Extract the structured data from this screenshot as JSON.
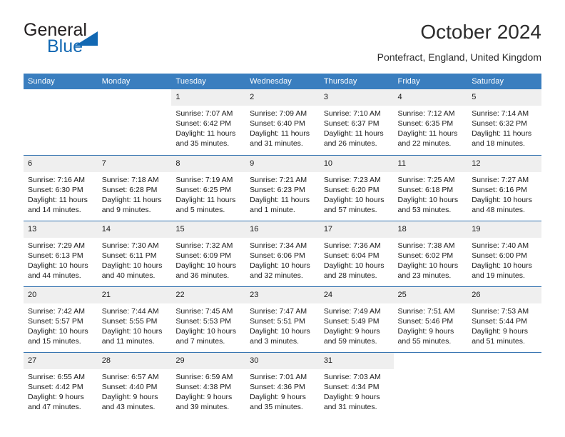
{
  "brand": {
    "word_top": "General",
    "word_bottom": "Blue",
    "accent_color": "#1268b3",
    "triangle_icon": "triangle-logo-icon"
  },
  "header": {
    "title": "October 2024",
    "subtitle": "Pontefract, England, United Kingdom"
  },
  "theme": {
    "header_row_bg": "#3a7ebf",
    "header_row_text": "#ffffff",
    "row_divider": "#2f6fae",
    "daynum_band_bg": "#efefef",
    "body_text": "#1a1a1a"
  },
  "labels": {
    "sunrise_prefix": "Sunrise:",
    "sunset_prefix": "Sunset:",
    "daylight_prefix": "Daylight:"
  },
  "weekday_headers": [
    "Sunday",
    "Monday",
    "Tuesday",
    "Wednesday",
    "Thursday",
    "Friday",
    "Saturday"
  ],
  "weeks": [
    [
      {
        "day": "",
        "sunrise": "",
        "sunset": "",
        "daylight": "",
        "blank": true
      },
      {
        "day": "",
        "sunrise": "",
        "sunset": "",
        "daylight": "",
        "blank": true
      },
      {
        "day": "1",
        "sunrise": "Sunrise: 7:07 AM",
        "sunset": "Sunset: 6:42 PM",
        "daylight": "Daylight: 11 hours and 35 minutes."
      },
      {
        "day": "2",
        "sunrise": "Sunrise: 7:09 AM",
        "sunset": "Sunset: 6:40 PM",
        "daylight": "Daylight: 11 hours and 31 minutes."
      },
      {
        "day": "3",
        "sunrise": "Sunrise: 7:10 AM",
        "sunset": "Sunset: 6:37 PM",
        "daylight": "Daylight: 11 hours and 26 minutes."
      },
      {
        "day": "4",
        "sunrise": "Sunrise: 7:12 AM",
        "sunset": "Sunset: 6:35 PM",
        "daylight": "Daylight: 11 hours and 22 minutes."
      },
      {
        "day": "5",
        "sunrise": "Sunrise: 7:14 AM",
        "sunset": "Sunset: 6:32 PM",
        "daylight": "Daylight: 11 hours and 18 minutes."
      }
    ],
    [
      {
        "day": "6",
        "sunrise": "Sunrise: 7:16 AM",
        "sunset": "Sunset: 6:30 PM",
        "daylight": "Daylight: 11 hours and 14 minutes."
      },
      {
        "day": "7",
        "sunrise": "Sunrise: 7:18 AM",
        "sunset": "Sunset: 6:28 PM",
        "daylight": "Daylight: 11 hours and 9 minutes."
      },
      {
        "day": "8",
        "sunrise": "Sunrise: 7:19 AM",
        "sunset": "Sunset: 6:25 PM",
        "daylight": "Daylight: 11 hours and 5 minutes."
      },
      {
        "day": "9",
        "sunrise": "Sunrise: 7:21 AM",
        "sunset": "Sunset: 6:23 PM",
        "daylight": "Daylight: 11 hours and 1 minute."
      },
      {
        "day": "10",
        "sunrise": "Sunrise: 7:23 AM",
        "sunset": "Sunset: 6:20 PM",
        "daylight": "Daylight: 10 hours and 57 minutes."
      },
      {
        "day": "11",
        "sunrise": "Sunrise: 7:25 AM",
        "sunset": "Sunset: 6:18 PM",
        "daylight": "Daylight: 10 hours and 53 minutes."
      },
      {
        "day": "12",
        "sunrise": "Sunrise: 7:27 AM",
        "sunset": "Sunset: 6:16 PM",
        "daylight": "Daylight: 10 hours and 48 minutes."
      }
    ],
    [
      {
        "day": "13",
        "sunrise": "Sunrise: 7:29 AM",
        "sunset": "Sunset: 6:13 PM",
        "daylight": "Daylight: 10 hours and 44 minutes."
      },
      {
        "day": "14",
        "sunrise": "Sunrise: 7:30 AM",
        "sunset": "Sunset: 6:11 PM",
        "daylight": "Daylight: 10 hours and 40 minutes."
      },
      {
        "day": "15",
        "sunrise": "Sunrise: 7:32 AM",
        "sunset": "Sunset: 6:09 PM",
        "daylight": "Daylight: 10 hours and 36 minutes."
      },
      {
        "day": "16",
        "sunrise": "Sunrise: 7:34 AM",
        "sunset": "Sunset: 6:06 PM",
        "daylight": "Daylight: 10 hours and 32 minutes."
      },
      {
        "day": "17",
        "sunrise": "Sunrise: 7:36 AM",
        "sunset": "Sunset: 6:04 PM",
        "daylight": "Daylight: 10 hours and 28 minutes."
      },
      {
        "day": "18",
        "sunrise": "Sunrise: 7:38 AM",
        "sunset": "Sunset: 6:02 PM",
        "daylight": "Daylight: 10 hours and 23 minutes."
      },
      {
        "day": "19",
        "sunrise": "Sunrise: 7:40 AM",
        "sunset": "Sunset: 6:00 PM",
        "daylight": "Daylight: 10 hours and 19 minutes."
      }
    ],
    [
      {
        "day": "20",
        "sunrise": "Sunrise: 7:42 AM",
        "sunset": "Sunset: 5:57 PM",
        "daylight": "Daylight: 10 hours and 15 minutes."
      },
      {
        "day": "21",
        "sunrise": "Sunrise: 7:44 AM",
        "sunset": "Sunset: 5:55 PM",
        "daylight": "Daylight: 10 hours and 11 minutes."
      },
      {
        "day": "22",
        "sunrise": "Sunrise: 7:45 AM",
        "sunset": "Sunset: 5:53 PM",
        "daylight": "Daylight: 10 hours and 7 minutes."
      },
      {
        "day": "23",
        "sunrise": "Sunrise: 7:47 AM",
        "sunset": "Sunset: 5:51 PM",
        "daylight": "Daylight: 10 hours and 3 minutes."
      },
      {
        "day": "24",
        "sunrise": "Sunrise: 7:49 AM",
        "sunset": "Sunset: 5:49 PM",
        "daylight": "Daylight: 9 hours and 59 minutes."
      },
      {
        "day": "25",
        "sunrise": "Sunrise: 7:51 AM",
        "sunset": "Sunset: 5:46 PM",
        "daylight": "Daylight: 9 hours and 55 minutes."
      },
      {
        "day": "26",
        "sunrise": "Sunrise: 7:53 AM",
        "sunset": "Sunset: 5:44 PM",
        "daylight": "Daylight: 9 hours and 51 minutes."
      }
    ],
    [
      {
        "day": "27",
        "sunrise": "Sunrise: 6:55 AM",
        "sunset": "Sunset: 4:42 PM",
        "daylight": "Daylight: 9 hours and 47 minutes."
      },
      {
        "day": "28",
        "sunrise": "Sunrise: 6:57 AM",
        "sunset": "Sunset: 4:40 PM",
        "daylight": "Daylight: 9 hours and 43 minutes."
      },
      {
        "day": "29",
        "sunrise": "Sunrise: 6:59 AM",
        "sunset": "Sunset: 4:38 PM",
        "daylight": "Daylight: 9 hours and 39 minutes."
      },
      {
        "day": "30",
        "sunrise": "Sunrise: 7:01 AM",
        "sunset": "Sunset: 4:36 PM",
        "daylight": "Daylight: 9 hours and 35 minutes."
      },
      {
        "day": "31",
        "sunrise": "Sunrise: 7:03 AM",
        "sunset": "Sunset: 4:34 PM",
        "daylight": "Daylight: 9 hours and 31 minutes."
      },
      {
        "day": "",
        "sunrise": "",
        "sunset": "",
        "daylight": "",
        "blank": true
      },
      {
        "day": "",
        "sunrise": "",
        "sunset": "",
        "daylight": "",
        "blank": true
      }
    ]
  ]
}
